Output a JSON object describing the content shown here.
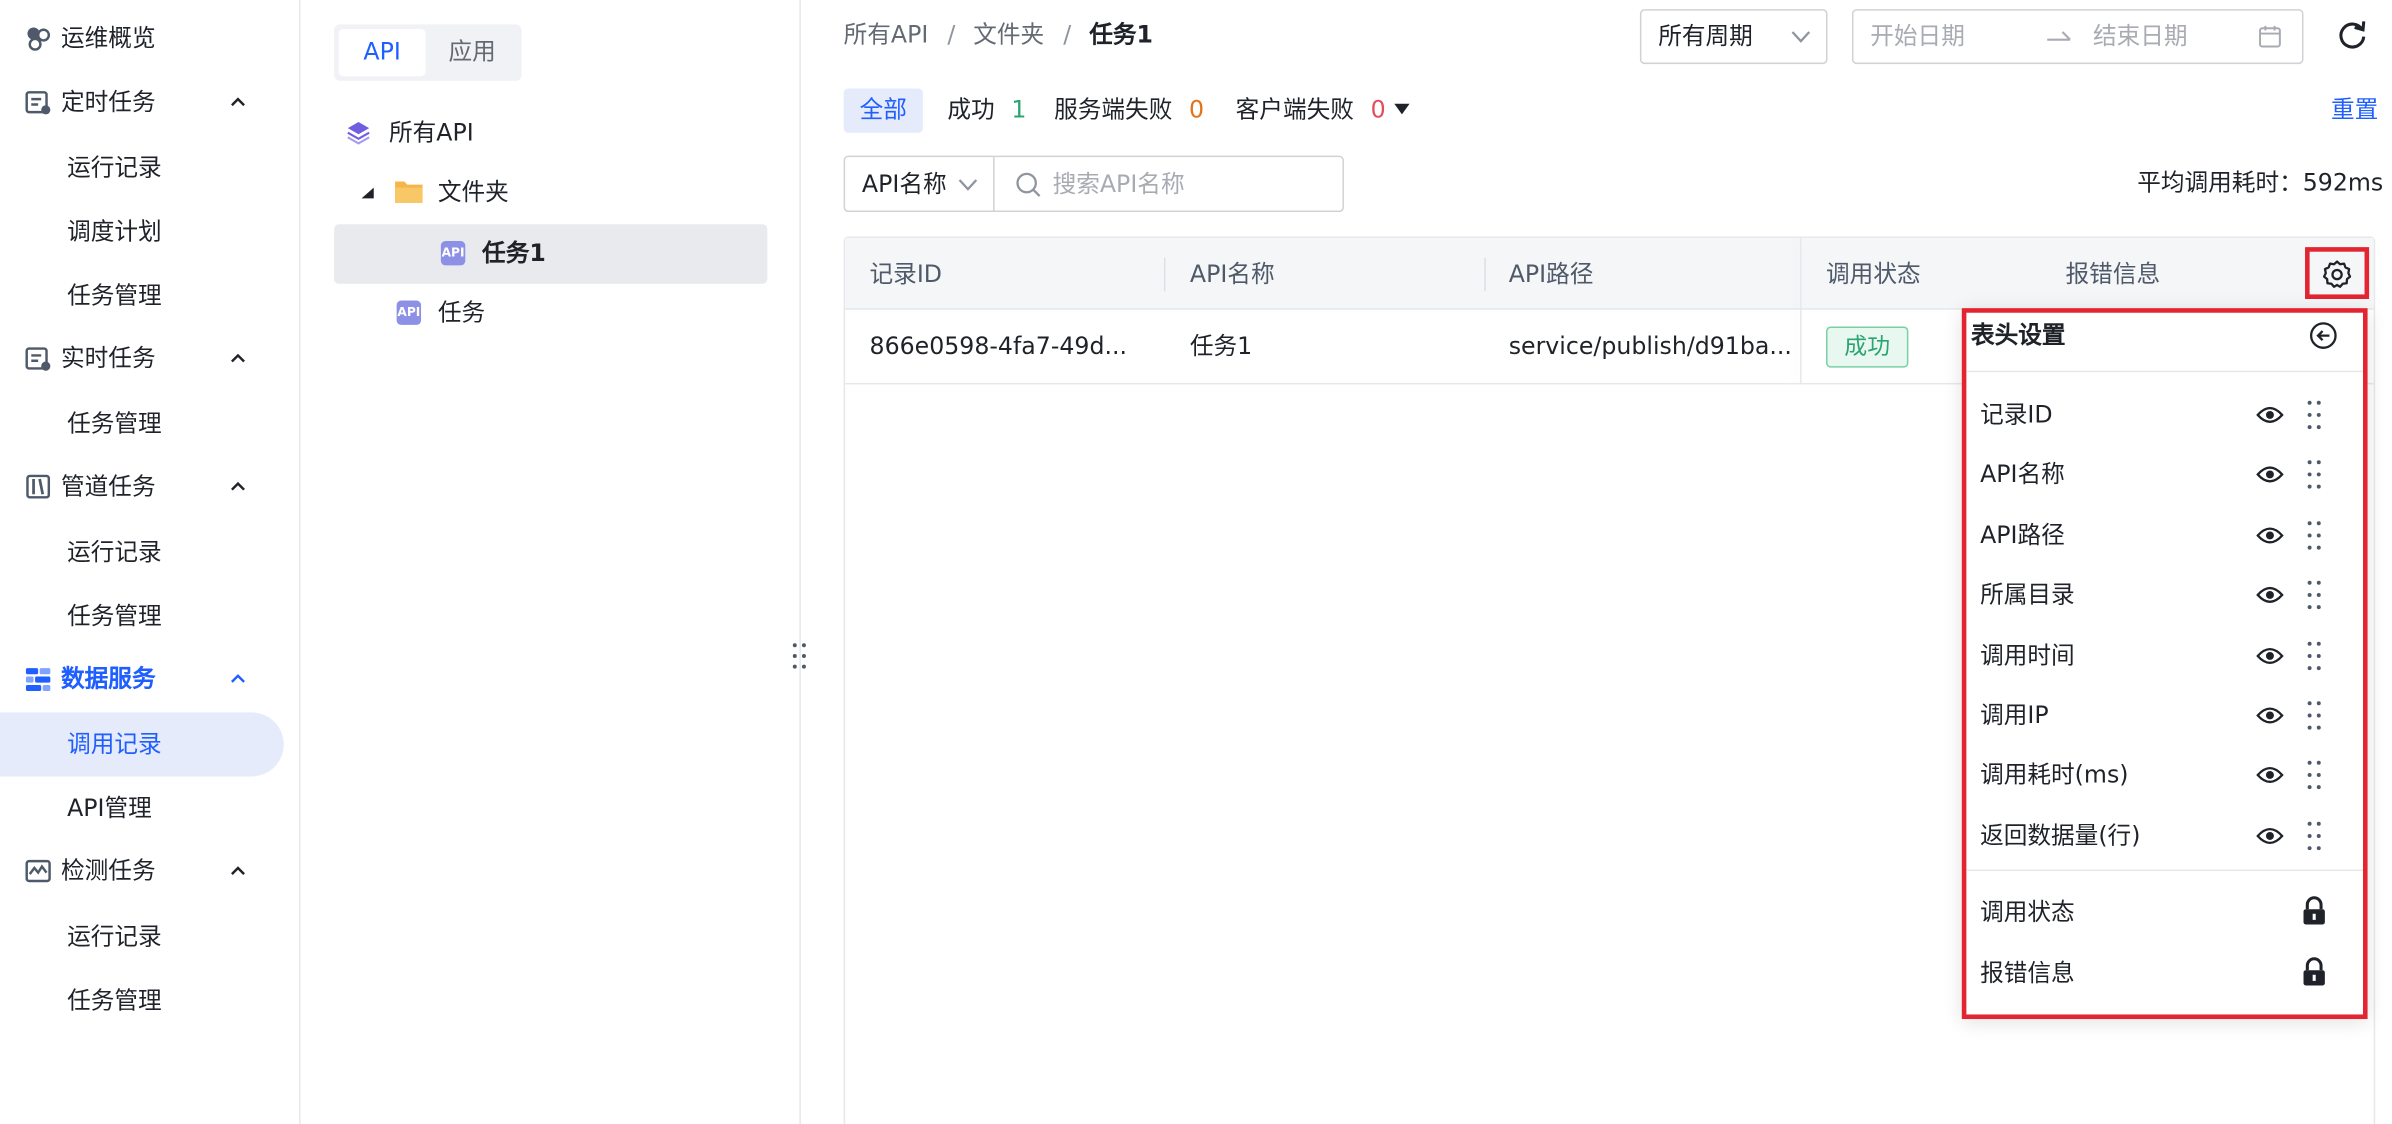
{
  "sidebar": {
    "groups": [
      {
        "label": "运维概览",
        "icon": "overview-icon"
      },
      {
        "label": "定时任务",
        "icon": "schedule-icon",
        "items": [
          "运行记录",
          "调度计划",
          "任务管理"
        ]
      },
      {
        "label": "实时任务",
        "icon": "realtime-icon",
        "items": [
          "任务管理"
        ]
      },
      {
        "label": "管道任务",
        "icon": "pipeline-icon",
        "items": [
          "运行记录",
          "任务管理"
        ]
      },
      {
        "label": "数据服务",
        "icon": "data-service-icon",
        "items": [
          "调用记录",
          "API管理"
        ]
      },
      {
        "label": "检测任务",
        "icon": "monitor-icon",
        "items": [
          "运行记录",
          "任务管理"
        ]
      }
    ],
    "active_item": "调用记录"
  },
  "tree": {
    "segment": [
      "API",
      "应用"
    ],
    "nodes": {
      "root": "所有API",
      "folder": "文件夹",
      "child": "任务1",
      "sibling": "任务"
    },
    "api_badge": "API"
  },
  "breadcrumb": [
    "所有API",
    "/",
    "文件夹",
    "/",
    "任务1"
  ],
  "filters": {
    "period": "所有周期",
    "start_placeholder": "开始日期",
    "end_placeholder": "结束日期",
    "search_field": "API名称",
    "search_placeholder": "搜索API名称"
  },
  "status_tabs": {
    "all": "全部",
    "success": "成功",
    "success_count": "1",
    "server_fail": "服务端失败",
    "server_fail_count": "0",
    "client_fail": "客户端失败",
    "client_fail_count": "0"
  },
  "reset": "重置",
  "avg_time": "平均调用耗时：592ms",
  "table": {
    "headers": [
      "记录ID",
      "API名称",
      "API路径",
      "调用状态",
      "报错信息"
    ],
    "rows": [
      {
        "id": "866e0598-4fa7-49d...",
        "name": "任务1",
        "path": "service/publish/d91ba...",
        "status": "成功"
      }
    ]
  },
  "header_settings": {
    "title": "表头设置",
    "columns": [
      "记录ID",
      "API名称",
      "API路径",
      "所属目录",
      "调用时间",
      "调用IP",
      "调用耗时(ms)",
      "返回数据量(行)"
    ],
    "locked_columns": [
      "调用状态",
      "报错信息"
    ]
  },
  "colors": {
    "accent": "#1f5eff",
    "success": "#2ba471",
    "warning": "#e37318",
    "danger": "#e34d59",
    "highlight": "#e32431"
  }
}
